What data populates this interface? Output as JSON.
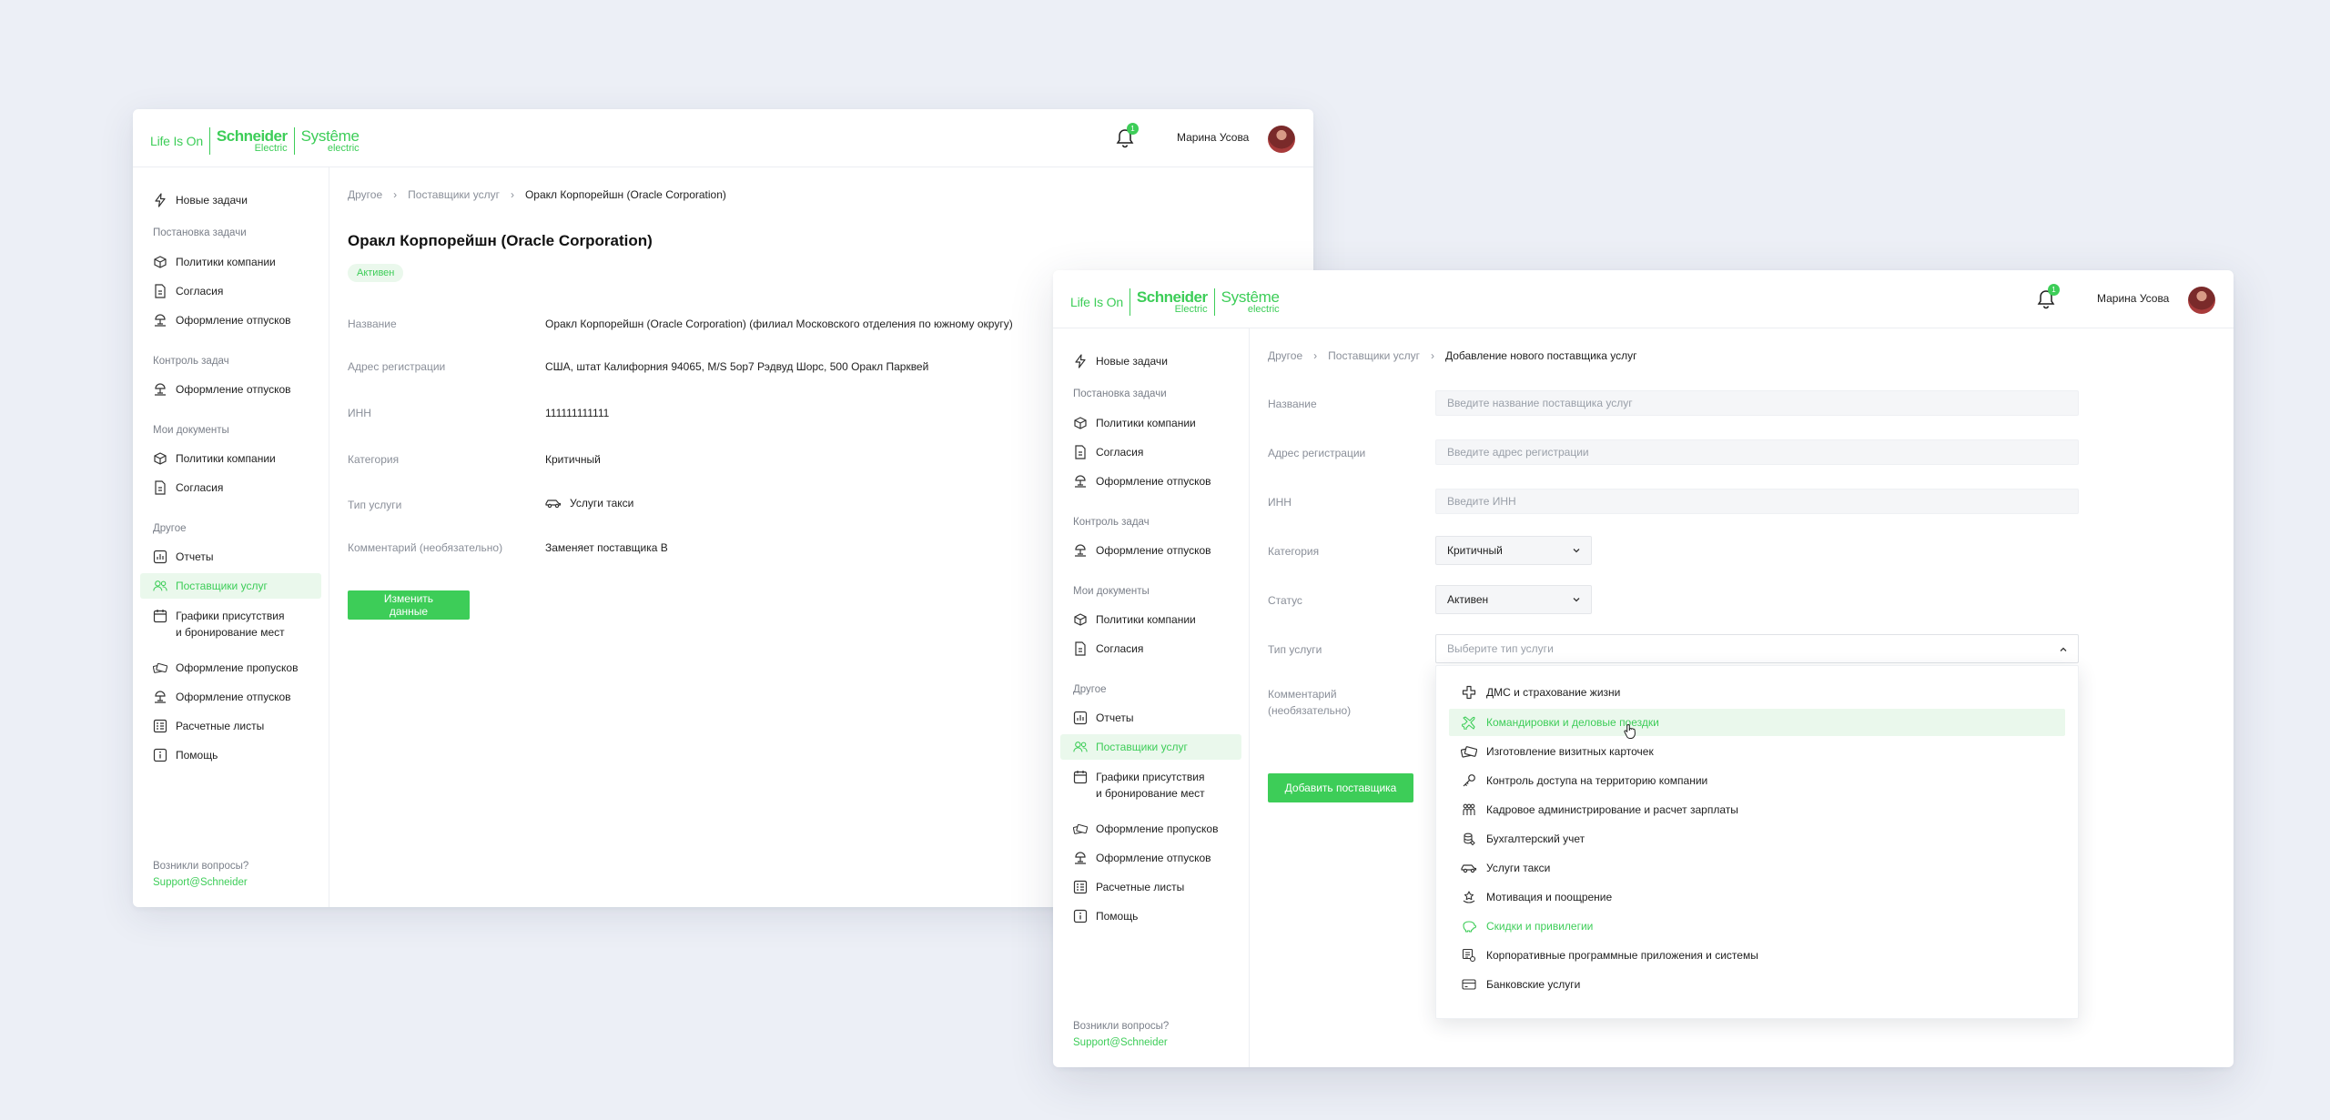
{
  "colors": {
    "accent": "#3dcd58",
    "accent_bg": "#eaf8ec",
    "muted_text": "#8a8f99",
    "background": "#eceff6"
  },
  "logo": {
    "life_is_on": "Life Is On",
    "schneider": "Schneider",
    "schneider_sub": "Electric",
    "systeme": "Systême",
    "systeme_sub": "electric"
  },
  "user": {
    "name": "Марина Усова",
    "notifications": "1"
  },
  "sidebar": {
    "new_tasks": "Новые задачи",
    "section_setting": "Постановка задачи",
    "policies": "Политики компании",
    "consents": "Согласия",
    "vacations": "Оформление отпусков",
    "section_control": "Контроль задач",
    "section_docs": "Мои документы",
    "section_other": "Другое",
    "reports": "Отчеты",
    "providers": "Поставщики услуг",
    "schedules_line1": "Графики присутствия",
    "schedules_line2": "и бронирование мест",
    "passes": "Оформление пропусков",
    "payslips": "Расчетные листы",
    "help": "Помощь",
    "footer_question": "Возникли вопросы?",
    "footer_link": "Support@Schneider"
  },
  "details": {
    "breadcrumb": [
      "Другое",
      "Поставщики услуг",
      "Оракл Корпорейшн (Oracle Corporation)"
    ],
    "title": "Оракл Корпорейшн (Oracle Corporation)",
    "status": "Активен",
    "fields": [
      {
        "label": "Название",
        "value": "Оракл Корпорейшн (Oracle Corporation) (филиал Московского отделения по южному округу)"
      },
      {
        "label": "Адрес регистрации",
        "value": "США, штат Калифорния 94065, M/S 5op7 Рэдвуд Шорс, 500 Оракл Парквей"
      },
      {
        "label": "ИНН",
        "value": "111111111111"
      },
      {
        "label": "Категория",
        "value": "Критичный"
      },
      {
        "label": "Тип услуги",
        "value": "Услуги такси"
      },
      {
        "label": "Комментарий (необязательно)",
        "value": "Заменяет поставщика B"
      }
    ],
    "edit_button": "Изменить данные"
  },
  "form": {
    "breadcrumb": [
      "Другое",
      "Поставщики услуг",
      "Добавление нового поставщика услуг"
    ],
    "name_label": "Название",
    "name_placeholder": "Введите название поставщика услуг",
    "address_label": "Адрес регистрации",
    "address_placeholder": "Введите адрес регистрации",
    "inn_label": "ИНН",
    "inn_placeholder": "Введите ИНН",
    "category_label": "Категория",
    "category_value": "Критичный",
    "status_label": "Статус",
    "status_value": "Активен",
    "service_label": "Тип услуги",
    "service_placeholder": "Выберите тип услуги",
    "comment_label_1": "Комментарий",
    "comment_label_2": "(необязательно)",
    "add_button": "Добавить поставщика",
    "service_options": [
      {
        "label": "ДМС и страхование жизни",
        "icon": "medical-cross-icon"
      },
      {
        "label": "Командировки  и деловые поездки",
        "icon": "airplane-icon",
        "state": "hover"
      },
      {
        "label": "Изготовление визитных карточек",
        "icon": "cards-icon"
      },
      {
        "label": "Контроль доступа на территорию компании",
        "icon": "key-icon"
      },
      {
        "label": "Кадровое администрирование и расчет зарплаты",
        "icon": "people-icon"
      },
      {
        "label": "Бухгалтерский учет",
        "icon": "coins-icon"
      },
      {
        "label": "Услуги такси",
        "icon": "car-icon"
      },
      {
        "label": "Мотивация и поощрение",
        "icon": "award-icon"
      },
      {
        "label": "Скидки и привилегии",
        "icon": "piggy-bank-icon",
        "state": "green"
      },
      {
        "label": "Корпоративные программные приложения и системы",
        "icon": "software-icon"
      },
      {
        "label": "Банковские услуги",
        "icon": "bank-card-icon"
      }
    ]
  }
}
